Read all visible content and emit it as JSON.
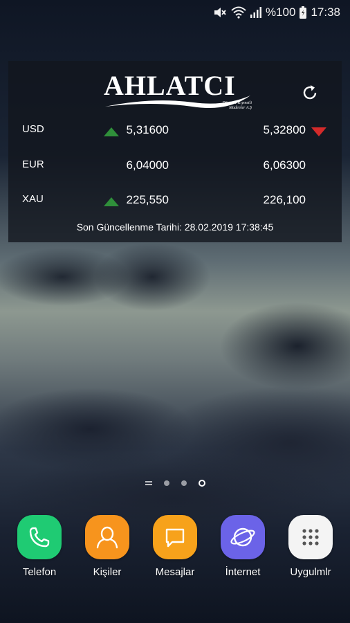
{
  "status_bar": {
    "battery": "%100",
    "time": "17:38",
    "icons": [
      "mute-icon",
      "wifi-icon",
      "signal-icon",
      "battery-icon"
    ]
  },
  "widget": {
    "logo": {
      "name": "AHLATCI",
      "subtitle_line1": "Döviz ve Kıymetli",
      "subtitle_line2": "Madenler A.Ş"
    },
    "refresh_icon": "refresh-icon",
    "rows": [
      {
        "code": "USD",
        "buy": "5,31600",
        "buy_trend": "up",
        "sell": "5,32800",
        "sell_trend": "down"
      },
      {
        "code": "EUR",
        "buy": "6,04000",
        "buy_trend": "none",
        "sell": "6,06300",
        "sell_trend": "none"
      },
      {
        "code": "XAU",
        "buy": "225,550",
        "buy_trend": "up",
        "sell": "226,100",
        "sell_trend": "none"
      }
    ],
    "last_update": "Son Güncellenme Tarihi: 28.02.2019   17:38:45",
    "colors": {
      "up": "#2f8f3a",
      "down": "#d42a2a",
      "background": "rgba(18,22,30,0.78)"
    }
  },
  "page_indicator": {
    "pages": 4,
    "current": 4
  },
  "dock": {
    "apps": [
      {
        "label": "Telefon",
        "icon": "phone-icon",
        "color": "#1fcb73"
      },
      {
        "label": "Kişiler",
        "icon": "contacts-icon",
        "color": "#f7941d"
      },
      {
        "label": "Mesajlar",
        "icon": "messages-icon",
        "color": "#f7a21b"
      },
      {
        "label": "İnternet",
        "icon": "internet-icon",
        "color": "#6b63e8"
      },
      {
        "label": "Uygulmlr",
        "icon": "apps-grid-icon",
        "color": "#f4f4f4"
      }
    ]
  }
}
